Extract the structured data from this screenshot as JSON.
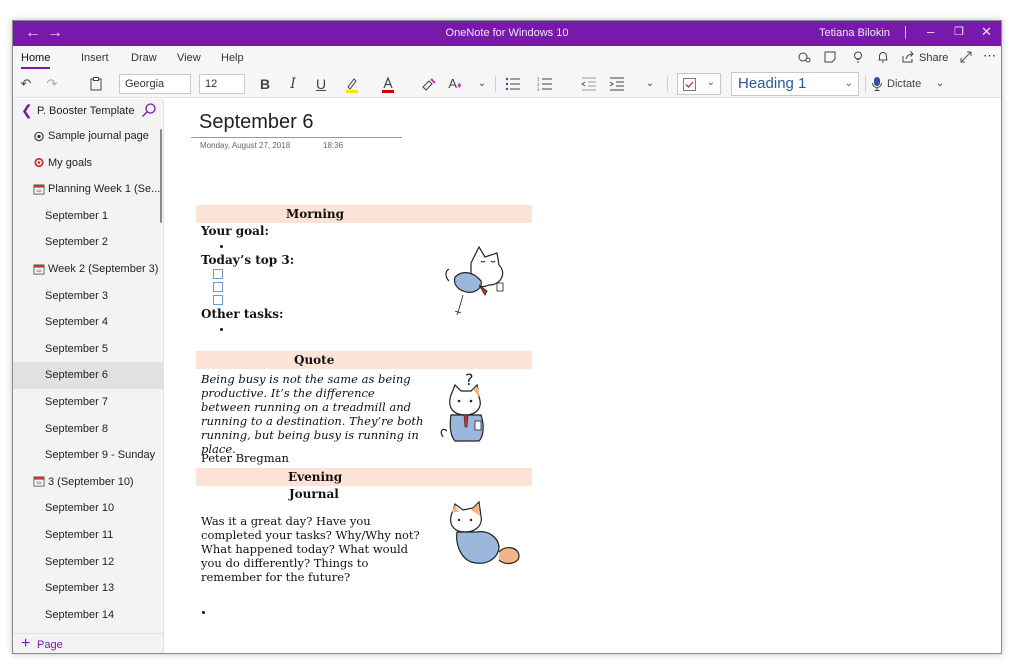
{
  "window": {
    "title": "OneNote for Windows 10",
    "user": "Tetiana Bilokin"
  },
  "ribbon": {
    "tabs": [
      "Home",
      "Insert",
      "Draw",
      "View",
      "Help"
    ],
    "share_label": "Share"
  },
  "toolbar": {
    "font_name": "Georgia",
    "font_size": "12",
    "style": "Heading 1",
    "dictate_label": "Dictate"
  },
  "sidebar": {
    "notebook": "P. Booster Template",
    "add_page_label": "Page",
    "pages": [
      {
        "label": "Sample journal page",
        "icon": "gear-icon"
      },
      {
        "label": "My goals",
        "icon": "target-icon"
      },
      {
        "label": "Planning Week 1 (Se...",
        "icon": "calendar-icon"
      },
      {
        "label": "September 1",
        "icon": ""
      },
      {
        "label": "September 2",
        "icon": ""
      },
      {
        "label": "Week 2 (September 3)",
        "icon": "calendar-icon"
      },
      {
        "label": "September 3",
        "icon": ""
      },
      {
        "label": "September 4",
        "icon": ""
      },
      {
        "label": "September 5",
        "icon": ""
      },
      {
        "label": "September 6",
        "icon": "",
        "selected": true
      },
      {
        "label": "September 7",
        "icon": ""
      },
      {
        "label": "September 8",
        "icon": ""
      },
      {
        "label": "September 9 - Sunday",
        "icon": ""
      },
      {
        "label": "3 (September 10)",
        "icon": "calendar-icon"
      },
      {
        "label": "September 10",
        "icon": ""
      },
      {
        "label": "September 11",
        "icon": ""
      },
      {
        "label": "September 12",
        "icon": ""
      },
      {
        "label": "September 13",
        "icon": ""
      },
      {
        "label": "September 14",
        "icon": ""
      }
    ]
  },
  "page": {
    "title": "September 6",
    "date": "Monday, August 27, 2018",
    "time": "18:36",
    "morning": {
      "header": "Morning",
      "your_goal": "Your goal:",
      "top3": "Today’s top 3:",
      "other_tasks": "Other tasks:"
    },
    "quote": {
      "header": "Quote",
      "text": "Being busy is not the same as being productive. It’s the difference between running on a treadmill and running to a destination. They’re both running, but being busy is running in place.",
      "author": "Peter Bregman"
    },
    "evening": {
      "header": "Evening",
      "subheader": "Journal",
      "text_line1": "Was it a great day? Have you completed your tasks? Why/Why not?",
      "text_line2": "What happened today? What would you do differently? Things to remember for the future?"
    }
  },
  "colors": {
    "accent": "#7719aa",
    "band": "#fbe3d5",
    "selected_page": "#e1e1e1",
    "heading_text": "#2b579a"
  }
}
